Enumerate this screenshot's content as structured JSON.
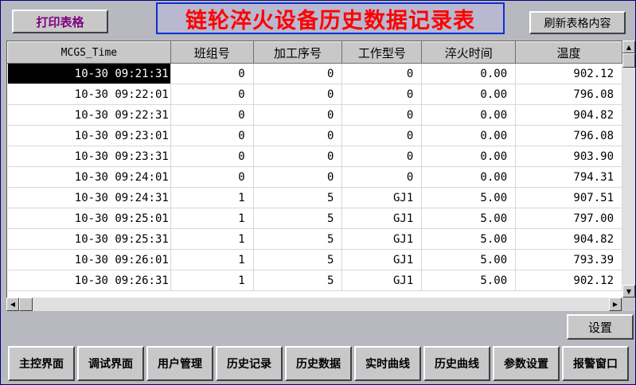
{
  "header": {
    "print_label": "打印表格",
    "title": "链轮淬火设备历史数据记录表",
    "refresh_label": "刷新表格内容"
  },
  "table": {
    "columns": [
      "MCGS_Time",
      "班组号",
      "加工序号",
      "工作型号",
      "淬火时间",
      "温度"
    ],
    "rows": [
      [
        "10-30 09:21:31",
        "0",
        "0",
        "0",
        "0.00",
        "902.12"
      ],
      [
        "10-30 09:22:01",
        "0",
        "0",
        "0",
        "0.00",
        "796.08"
      ],
      [
        "10-30 09:22:31",
        "0",
        "0",
        "0",
        "0.00",
        "904.82"
      ],
      [
        "10-30 09:23:01",
        "0",
        "0",
        "0",
        "0.00",
        "796.08"
      ],
      [
        "10-30 09:23:31",
        "0",
        "0",
        "0",
        "0.00",
        "903.90"
      ],
      [
        "10-30 09:24:01",
        "0",
        "0",
        "0",
        "0.00",
        "794.31"
      ],
      [
        "10-30 09:24:31",
        "1",
        "5",
        "GJ1",
        "5.00",
        "907.51"
      ],
      [
        "10-30 09:25:01",
        "1",
        "5",
        "GJ1",
        "5.00",
        "797.00"
      ],
      [
        "10-30 09:25:31",
        "1",
        "5",
        "GJ1",
        "5.00",
        "904.82"
      ],
      [
        "10-30 09:26:01",
        "1",
        "5",
        "GJ1",
        "5.00",
        "793.39"
      ],
      [
        "10-30 09:26:31",
        "1",
        "5",
        "GJ1",
        "5.00",
        "902.12"
      ]
    ]
  },
  "settings_label": "设置",
  "nav": [
    "主控界面",
    "调试界面",
    "用户管理",
    "历史记录",
    "历史数据",
    "实时曲线",
    "历史曲线",
    "参数设置",
    "报警窗口"
  ],
  "colors": {
    "title_text": "#ff0000",
    "print_text": "#800080",
    "title_border": "#1030d0",
    "selection": "#000000"
  },
  "icons": [
    "scroll-up-icon",
    "scroll-down-icon",
    "scroll-left-icon",
    "scroll-right-icon"
  ]
}
